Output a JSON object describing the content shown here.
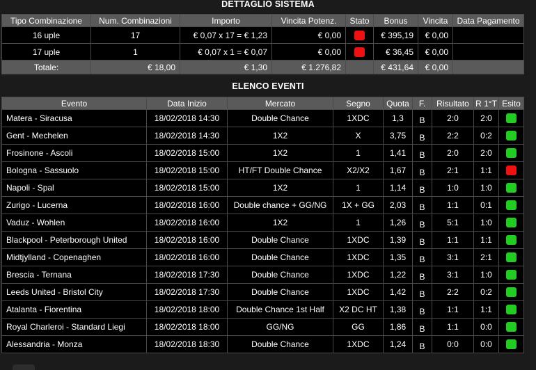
{
  "system": {
    "title": "DETTAGLIO SISTEMA",
    "headers": [
      "Tipo Combinazione",
      "Num. Combinazioni",
      "Importo",
      "Vincita Potenz.",
      "Stato",
      "Bonus",
      "Vincita",
      "Data Pagamento"
    ],
    "rows": [
      {
        "tipo": "16 uple",
        "num": "17",
        "importo": "€ 0,07 x 17 = € 1,23",
        "vincita_potenz": "€ 0,00",
        "stato_color": "#ee1111",
        "bonus": "€ 395,19",
        "vincita": "€ 0,00",
        "data_pagamento": ""
      },
      {
        "tipo": "17 uple",
        "num": "1",
        "importo": "€ 0,07 x 1 = € 0,07",
        "vincita_potenz": "€ 0,00",
        "stato_color": "#ee1111",
        "bonus": "€ 36,45",
        "vincita": "€ 0,00",
        "data_pagamento": ""
      }
    ],
    "total": {
      "label": "Totale:",
      "num": "€ 18,00",
      "importo": "€ 1,30",
      "vincita_potenz": "€ 1.276,82",
      "bonus": "€ 431,64",
      "vincita": "€ 0,00"
    }
  },
  "events": {
    "title": "ELENCO EVENTI",
    "headers": [
      "Evento",
      "Data Inizio",
      "Mercato",
      "Segno",
      "Quota",
      "F.",
      "Risultato",
      "R 1°T",
      "Esito"
    ],
    "rows": [
      {
        "evento": "Matera - Siracusa",
        "data": "18/02/2018 14:30",
        "mercato": "Double Chance",
        "segno": "1XDC",
        "quota": "1,3",
        "f": "B",
        "risultato": "2:0",
        "r1t": "2:0",
        "esito": "win"
      },
      {
        "evento": "Gent - Mechelen",
        "data": "18/02/2018 14:30",
        "mercato": "1X2",
        "segno": "X",
        "quota": "3,75",
        "f": "B",
        "risultato": "2:2",
        "r1t": "0:2",
        "esito": "win"
      },
      {
        "evento": "Frosinone - Ascoli",
        "data": "18/02/2018 15:00",
        "mercato": "1X2",
        "segno": "1",
        "quota": "1,41",
        "f": "B",
        "risultato": "2:0",
        "r1t": "2:0",
        "esito": "win"
      },
      {
        "evento": "Bologna - Sassuolo",
        "data": "18/02/2018 15:00",
        "mercato": "HT/FT Double Chance",
        "segno": "X2/X2",
        "quota": "1,67",
        "f": "B",
        "risultato": "2:1",
        "r1t": "1:1",
        "esito": "lose"
      },
      {
        "evento": "Napoli - Spal",
        "data": "18/02/2018 15:00",
        "mercato": "1X2",
        "segno": "1",
        "quota": "1,14",
        "f": "B",
        "risultato": "1:0",
        "r1t": "1:0",
        "esito": "win"
      },
      {
        "evento": "Zurigo - Lucerna",
        "data": "18/02/2018 16:00",
        "mercato": "Double chance + GG/NG",
        "segno": "1X + GG",
        "quota": "2,03",
        "f": "B",
        "risultato": "1:1",
        "r1t": "0:1",
        "esito": "win"
      },
      {
        "evento": "Vaduz - Wohlen",
        "data": "18/02/2018 16:00",
        "mercato": "1X2",
        "segno": "1",
        "quota": "1,26",
        "f": "B",
        "risultato": "5:1",
        "r1t": "1:0",
        "esito": "win"
      },
      {
        "evento": "Blackpool - Peterborough United",
        "data": "18/02/2018 16:00",
        "mercato": "Double Chance",
        "segno": "1XDC",
        "quota": "1,39",
        "f": "B",
        "risultato": "1:1",
        "r1t": "1:1",
        "esito": "win"
      },
      {
        "evento": "Midtjylland - Copenaghen",
        "data": "18/02/2018 16:00",
        "mercato": "Double Chance",
        "segno": "1XDC",
        "quota": "1,35",
        "f": "B",
        "risultato": "3:1",
        "r1t": "2:1",
        "esito": "win"
      },
      {
        "evento": "Brescia - Ternana",
        "data": "18/02/2018 17:30",
        "mercato": "Double Chance",
        "segno": "1XDC",
        "quota": "1,22",
        "f": "B",
        "risultato": "3:1",
        "r1t": "1:0",
        "esito": "win"
      },
      {
        "evento": "Leeds United - Bristol City",
        "data": "18/02/2018 17:30",
        "mercato": "Double Chance",
        "segno": "1XDC",
        "quota": "1,42",
        "f": "B",
        "risultato": "2:2",
        "r1t": "0:2",
        "esito": "win"
      },
      {
        "evento": "Atalanta - Fiorentina",
        "data": "18/02/2018 18:00",
        "mercato": "Double Chance 1st Half",
        "segno": "X2 DC HT",
        "quota": "1,38",
        "f": "B",
        "risultato": "1:1",
        "r1t": "1:1",
        "esito": "win"
      },
      {
        "evento": "Royal Charleroi - Standard Liegi",
        "data": "18/02/2018 18:00",
        "mercato": "GG/NG",
        "segno": "GG",
        "quota": "1,86",
        "f": "B",
        "risultato": "1:1",
        "r1t": "0:0",
        "esito": "win"
      },
      {
        "evento": "Alessandria - Monza",
        "data": "18/02/2018 18:30",
        "mercato": "Double Chance",
        "segno": "1XDC",
        "quota": "1,24",
        "f": "B",
        "risultato": "0:0",
        "r1t": "0:0",
        "esito": "win"
      }
    ]
  },
  "colors": {
    "win": "#22cc22",
    "lose": "#ee1111",
    "header_bg": "#5a5a5a",
    "row_bg": "#000000"
  }
}
